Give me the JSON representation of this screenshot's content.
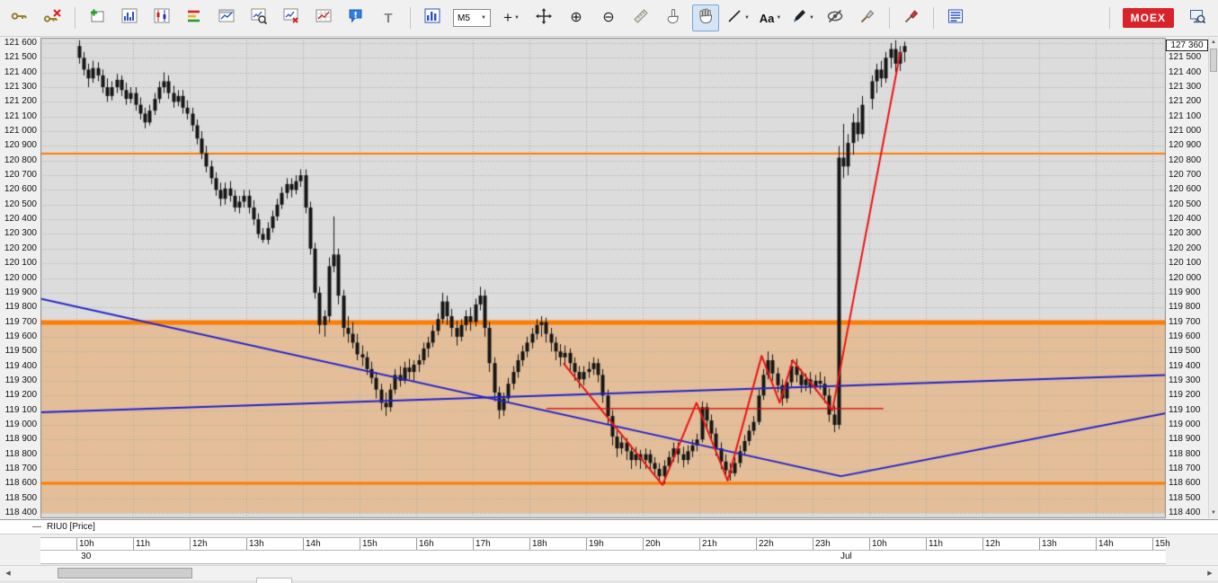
{
  "icons": {
    "caret_down": "▼",
    "zoom_in": "⊕",
    "zoom_out": "⊖",
    "crosshair": "+",
    "scroll_up": "▲",
    "scroll_down": "▼",
    "scroll_left": "◀",
    "scroll_right": "▶",
    "dash": "—"
  },
  "toolbar": {
    "timeframe": "M5",
    "text_tool": "T",
    "font_tool": "Aa",
    "moex": "MOEX"
  },
  "chart_data": {
    "type": "candlestick",
    "instrument": "RIU0 [Price]",
    "timeframe": "M5",
    "price_box": "127 360",
    "ylim": [
      118400,
      121600
    ],
    "ytick_step": 100,
    "grid": true,
    "colors": {
      "plot_bg": "#dcdcdc",
      "grid": "#a9a9a9",
      "candle": "#161616",
      "level_orange": "#ff7d00",
      "trendline_blue": "#2222cc",
      "zigzag_red": "#ea1515"
    },
    "hour_labels": [
      "10h",
      "11h",
      "12h",
      "13h",
      "14h",
      "15h",
      "16h",
      "17h",
      "18h",
      "19h",
      "20h",
      "21h",
      "22h",
      "23h",
      "10h",
      "11h",
      "12h",
      "13h",
      "14h",
      "15h"
    ],
    "date_labels": [
      {
        "label": "30",
        "t": 0.05
      },
      {
        "label": "Jul",
        "t": 13.46
      }
    ],
    "levels_orange": [
      {
        "price": 120850,
        "width": 2
      },
      {
        "price": 119700,
        "width": 5
      },
      {
        "price": 118600,
        "width": 3
      }
    ],
    "band": {
      "from": 119700,
      "to": 118400,
      "color": "rgba(236,148,58,0.42)"
    },
    "trendlines": [
      {
        "color": "#2222cc",
        "points": [
          [
            -0.64,
            119860
          ],
          [
            13.5,
            118650
          ],
          [
            19.25,
            119080
          ]
        ]
      },
      {
        "color": "#2222cc",
        "points": [
          [
            -0.64,
            119085
          ],
          [
            19.25,
            119340
          ]
        ]
      }
    ],
    "zigzag": {
      "color": "#ea1515",
      "points": [
        [
          8.6,
          119420
        ],
        [
          10.35,
          118590
        ],
        [
          10.95,
          119150
        ],
        [
          11.5,
          118620
        ],
        [
          12.1,
          119470
        ],
        [
          12.42,
          119150
        ],
        [
          12.65,
          119440
        ],
        [
          13.35,
          119100
        ],
        [
          14.55,
          121540
        ]
      ]
    },
    "red_hline": {
      "price": 119110,
      "t1": 8.3,
      "t2": 14.25,
      "color": "#d40000"
    },
    "candle_minutes": 5,
    "candles": [
      [
        121580,
        121620,
        121460,
        121500
      ],
      [
        121500,
        121540,
        121380,
        121420
      ],
      [
        121420,
        121460,
        121300,
        121360
      ],
      [
        121360,
        121480,
        121330,
        121430
      ],
      [
        121430,
        121470,
        121340,
        121380
      ],
      [
        121380,
        121420,
        121260,
        121300
      ],
      [
        121300,
        121360,
        121200,
        121240
      ],
      [
        121240,
        121340,
        121210,
        121300
      ],
      [
        121300,
        121390,
        121260,
        121350
      ],
      [
        121350,
        121380,
        121240,
        121280
      ],
      [
        121280,
        121330,
        121180,
        121220
      ],
      [
        121220,
        121300,
        121190,
        121260
      ],
      [
        121260,
        121300,
        121140,
        121180
      ],
      [
        121180,
        121230,
        121080,
        121120
      ],
      [
        121120,
        121160,
        121020,
        121060
      ],
      [
        121060,
        121180,
        121040,
        121140
      ],
      [
        121140,
        121260,
        121110,
        121220
      ],
      [
        121220,
        121340,
        121190,
        121300
      ],
      [
        121300,
        121400,
        121260,
        121340
      ],
      [
        121340,
        121380,
        121220,
        121260
      ],
      [
        121260,
        121310,
        121160,
        121200
      ],
      [
        121200,
        121280,
        121170,
        121240
      ],
      [
        121240,
        121280,
        121120,
        121160
      ],
      [
        121160,
        121210,
        121080,
        121120
      ],
      [
        121120,
        121160,
        121000,
        121040
      ],
      [
        121040,
        121080,
        120910,
        120950
      ],
      [
        120950,
        121000,
        120810,
        120850
      ],
      [
        120850,
        120900,
        120720,
        120760
      ],
      [
        120760,
        120800,
        120640,
        120680
      ],
      [
        120680,
        120720,
        120560,
        120600
      ],
      [
        120600,
        120650,
        120490,
        120540
      ],
      [
        120540,
        120650,
        120500,
        120610
      ],
      [
        120610,
        120660,
        120520,
        120560
      ],
      [
        120560,
        120600,
        120450,
        120480
      ],
      [
        120480,
        120560,
        120440,
        120520
      ],
      [
        120520,
        120600,
        120480,
        120560
      ],
      [
        120560,
        120600,
        120440,
        120480
      ],
      [
        120480,
        120530,
        120360,
        120400
      ],
      [
        120400,
        120440,
        120270,
        120300
      ],
      [
        120300,
        120340,
        120240,
        120260
      ],
      [
        120260,
        120380,
        120230,
        120340
      ],
      [
        120340,
        120460,
        120310,
        120420
      ],
      [
        120420,
        120540,
        120390,
        120500
      ],
      [
        120500,
        120620,
        120470,
        120580
      ],
      [
        120580,
        120680,
        120540,
        120640
      ],
      [
        120640,
        120680,
        120550,
        120600
      ],
      [
        120600,
        120700,
        120570,
        120660
      ],
      [
        120660,
        120740,
        120620,
        120700
      ],
      [
        120700,
        120740,
        120440,
        120480
      ],
      [
        120480,
        120520,
        120160,
        120200
      ],
      [
        120200,
        120240,
        119860,
        119900
      ],
      [
        119900,
        119940,
        119620,
        119680
      ],
      [
        119680,
        119780,
        119600,
        119740
      ],
      [
        119740,
        120140,
        119700,
        120080
      ],
      [
        120080,
        120420,
        120040,
        120160
      ],
      [
        120160,
        120200,
        119820,
        119880
      ],
      [
        119880,
        119920,
        119600,
        119660
      ],
      [
        119660,
        119740,
        119560,
        119620
      ],
      [
        119620,
        119700,
        119520,
        119560
      ],
      [
        119560,
        119620,
        119440,
        119480
      ],
      [
        119480,
        119540,
        119400,
        119460
      ],
      [
        119460,
        119500,
        119340,
        119380
      ],
      [
        119380,
        119430,
        119280,
        119320
      ],
      [
        119320,
        119360,
        119180,
        119240
      ],
      [
        119240,
        119280,
        119100,
        119150
      ],
      [
        119150,
        119220,
        119060,
        119120
      ],
      [
        119120,
        119280,
        119090,
        119240
      ],
      [
        119240,
        119380,
        119210,
        119340
      ],
      [
        119340,
        119400,
        119260,
        119300
      ],
      [
        119300,
        119430,
        119280,
        119390
      ],
      [
        119390,
        119450,
        119310,
        119360
      ],
      [
        119360,
        119440,
        119300,
        119410
      ],
      [
        119410,
        119480,
        119360,
        119440
      ],
      [
        119440,
        119560,
        119410,
        119520
      ],
      [
        119520,
        119600,
        119460,
        119560
      ],
      [
        119560,
        119680,
        119530,
        119640
      ],
      [
        119640,
        119760,
        119610,
        119720
      ],
      [
        119720,
        119900,
        119690,
        119840
      ],
      [
        119840,
        119880,
        119680,
        119740
      ],
      [
        119740,
        119790,
        119600,
        119660
      ],
      [
        119660,
        119710,
        119540,
        119600
      ],
      [
        119600,
        119720,
        119570,
        119680
      ],
      [
        119680,
        119780,
        119640,
        119740
      ],
      [
        119740,
        119800,
        119640,
        119700
      ],
      [
        119700,
        119860,
        119670,
        119820
      ],
      [
        119820,
        119940,
        119780,
        119880
      ],
      [
        119880,
        119920,
        119600,
        119660
      ],
      [
        119660,
        119700,
        119360,
        119420
      ],
      [
        119420,
        119460,
        119160,
        119220
      ],
      [
        119220,
        119260,
        119040,
        119100
      ],
      [
        119100,
        119220,
        119060,
        119180
      ],
      [
        119180,
        119320,
        119150,
        119280
      ],
      [
        119280,
        119400,
        119240,
        119360
      ],
      [
        119360,
        119480,
        119320,
        119440
      ],
      [
        119440,
        119540,
        119400,
        119500
      ],
      [
        119500,
        119600,
        119460,
        119560
      ],
      [
        119560,
        119660,
        119520,
        119620
      ],
      [
        119620,
        119720,
        119580,
        119680
      ],
      [
        119680,
        119740,
        119600,
        119700
      ],
      [
        119700,
        119730,
        119560,
        119620
      ],
      [
        119620,
        119660,
        119500,
        119560
      ],
      [
        119560,
        119600,
        119440,
        119500
      ],
      [
        119500,
        119550,
        119400,
        119460
      ],
      [
        119460,
        119540,
        119410,
        119490
      ],
      [
        119490,
        119520,
        119360,
        119420
      ],
      [
        119420,
        119460,
        119300,
        119360
      ],
      [
        119360,
        119400,
        119250,
        119310
      ],
      [
        119310,
        119400,
        119270,
        119360
      ],
      [
        119360,
        119430,
        119320,
        119380
      ],
      [
        119380,
        119460,
        119340,
        119420
      ],
      [
        119420,
        119450,
        119290,
        119340
      ],
      [
        119340,
        119380,
        119150,
        119200
      ],
      [
        119200,
        119240,
        119000,
        119060
      ],
      [
        119060,
        119100,
        118860,
        118920
      ],
      [
        118920,
        118960,
        118780,
        118840
      ],
      [
        118840,
        118930,
        118800,
        118880
      ],
      [
        118880,
        118910,
        118760,
        118820
      ],
      [
        118820,
        118860,
        118700,
        118760
      ],
      [
        118760,
        118850,
        118720,
        118800
      ],
      [
        118800,
        118830,
        118700,
        118760
      ],
      [
        118760,
        118840,
        118700,
        118800
      ],
      [
        118800,
        118830,
        118690,
        118740
      ],
      [
        118740,
        118780,
        118650,
        118700
      ],
      [
        118700,
        118740,
        118610,
        118650
      ],
      [
        118650,
        118760,
        118600,
        118720
      ],
      [
        118720,
        118820,
        118690,
        118780
      ],
      [
        118780,
        118880,
        118750,
        118840
      ],
      [
        118840,
        118880,
        118740,
        118800
      ],
      [
        118800,
        118850,
        118710,
        118760
      ],
      [
        118760,
        118860,
        118730,
        118820
      ],
      [
        118820,
        118900,
        118780,
        118860
      ],
      [
        118860,
        118940,
        118820,
        118900
      ],
      [
        118900,
        119160,
        118880,
        119120
      ],
      [
        119120,
        119150,
        118980,
        119030
      ],
      [
        119030,
        119070,
        118890,
        118940
      ],
      [
        118940,
        118980,
        118790,
        118840
      ],
      [
        118840,
        118880,
        118700,
        118750
      ],
      [
        118750,
        118800,
        118640,
        118690
      ],
      [
        118690,
        118740,
        118620,
        118670
      ],
      [
        118670,
        118780,
        118650,
        118740
      ],
      [
        118740,
        118860,
        118710,
        118820
      ],
      [
        118820,
        118930,
        118790,
        118890
      ],
      [
        118890,
        119000,
        118860,
        118960
      ],
      [
        118960,
        119060,
        118930,
        119020
      ],
      [
        119020,
        119240,
        119000,
        119200
      ],
      [
        119200,
        119380,
        119170,
        119340
      ],
      [
        119340,
        119500,
        119310,
        119440
      ],
      [
        119440,
        119480,
        119300,
        119350
      ],
      [
        119350,
        119390,
        119220,
        119270
      ],
      [
        119270,
        119310,
        119130,
        119180
      ],
      [
        119180,
        119330,
        119150,
        119290
      ],
      [
        119290,
        119440,
        119260,
        119400
      ],
      [
        119400,
        119450,
        119290,
        119340
      ],
      [
        119340,
        119380,
        119220,
        119270
      ],
      [
        119270,
        119350,
        119230,
        119310
      ],
      [
        119310,
        119360,
        119210,
        119260
      ],
      [
        119260,
        119340,
        119230,
        119300
      ],
      [
        119300,
        119360,
        119240,
        119280
      ],
      [
        119280,
        119330,
        119150,
        119200
      ],
      [
        119200,
        119250,
        119020,
        119070
      ],
      [
        119070,
        119130,
        118950,
        119000
      ],
      [
        119000,
        120900,
        118970,
        120820
      ],
      [
        120820,
        121050,
        120680,
        120760
      ],
      [
        120760,
        120980,
        120700,
        120920
      ],
      [
        120920,
        121120,
        120840,
        121060
      ],
      [
        121060,
        121160,
        120930,
        120980
      ],
      [
        120980,
        121240,
        120950,
        121180
      ],
      null,
      [
        121220,
        121380,
        121150,
        121340
      ],
      [
        121340,
        121460,
        121260,
        121420
      ],
      [
        121420,
        121480,
        121300,
        121360
      ],
      [
        121360,
        121540,
        121330,
        121500
      ],
      [
        121500,
        121600,
        121430,
        121560
      ],
      [
        121560,
        121620,
        121400,
        121460
      ],
      [
        121460,
        121580,
        121410,
        121540
      ],
      [
        121540,
        121610,
        121470,
        121580
      ]
    ]
  }
}
